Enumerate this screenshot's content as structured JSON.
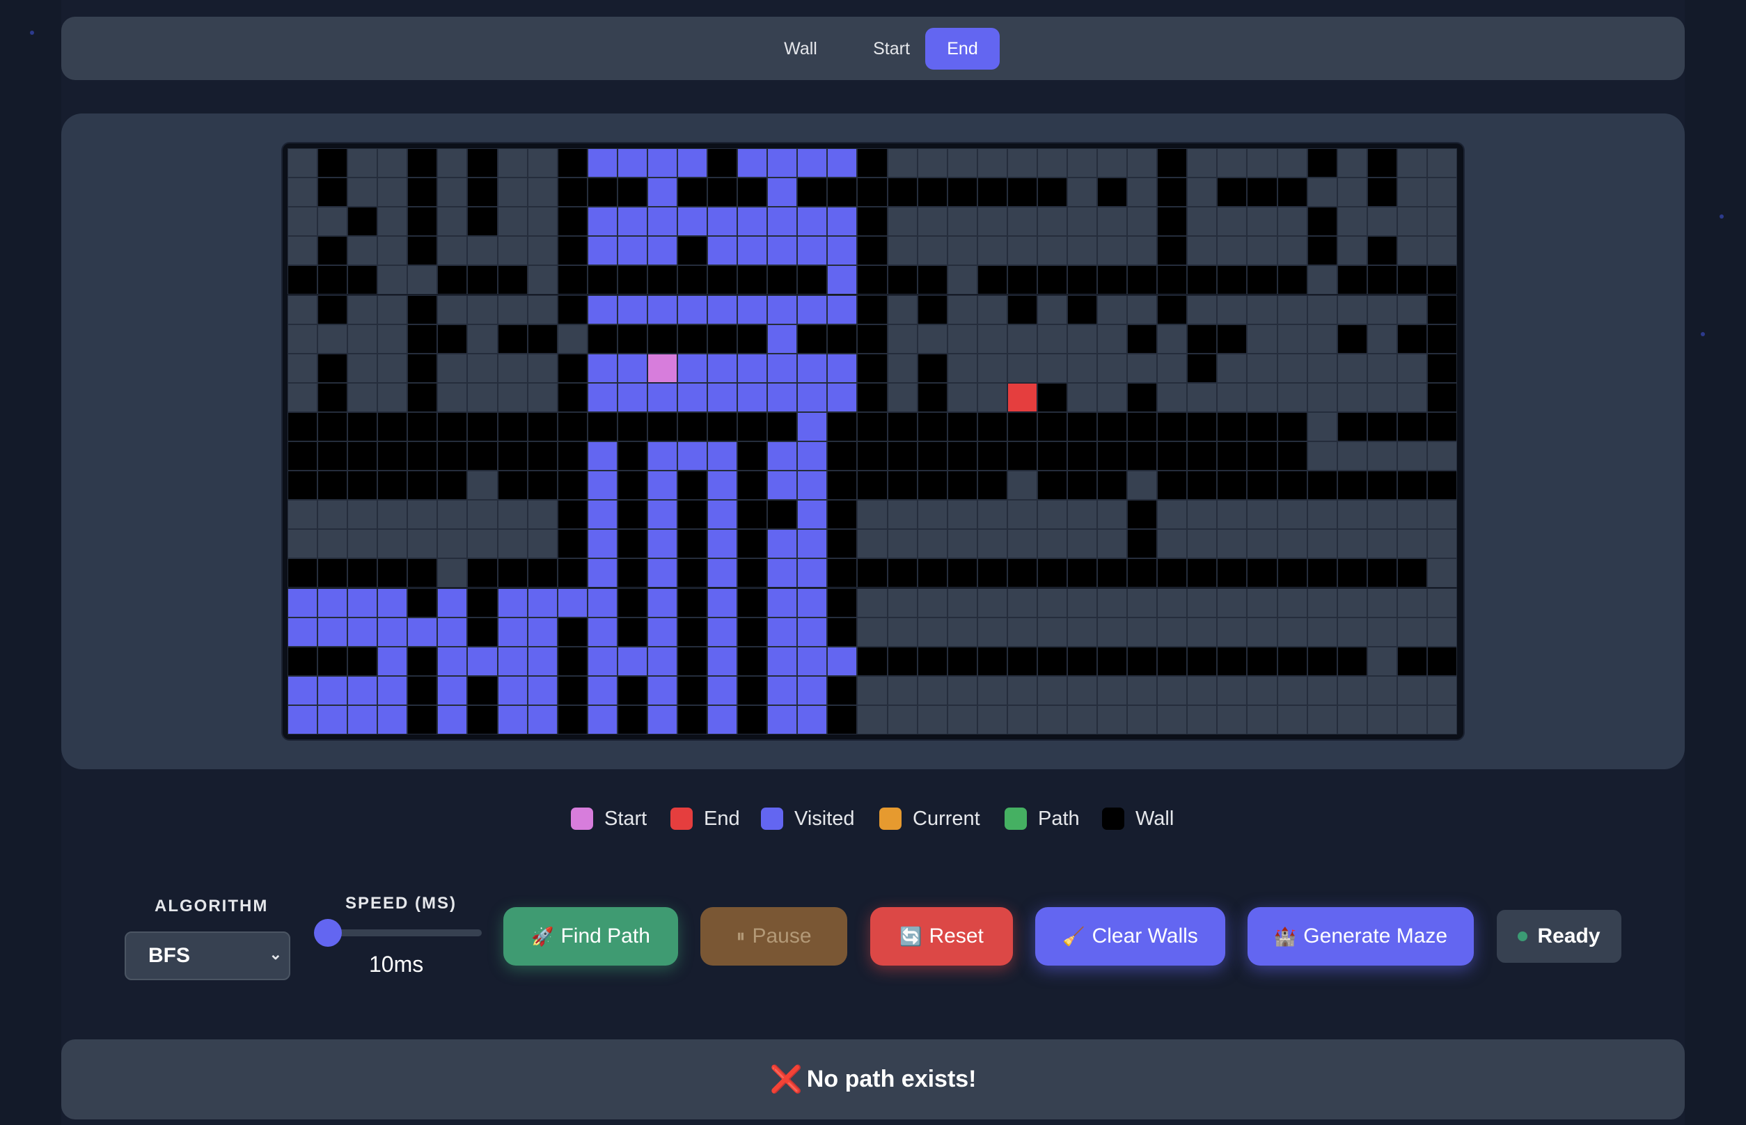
{
  "modes": {
    "items": [
      "Wall",
      "Start",
      "End"
    ],
    "active": "End"
  },
  "legend": [
    {
      "label": "Start",
      "color": "#d77ddc"
    },
    {
      "label": "End",
      "color": "#e53e3e"
    },
    {
      "label": "Visited",
      "color": "#6366f1"
    },
    {
      "label": "Current",
      "color": "#e69a2f"
    },
    {
      "label": "Path",
      "color": "#45b062"
    },
    {
      "label": "Wall",
      "color": "#000000"
    }
  ],
  "controls": {
    "algorithm_label": "ALGORITHM",
    "algorithm_value": "BFS",
    "speed_label": "SPEED (MS)",
    "speed_value": "10ms",
    "speed_level": 0
  },
  "buttons": {
    "find_path": {
      "icon": "rocket-icon",
      "glyph": "🚀",
      "label": "Find Path"
    },
    "pause": {
      "icon": "pause-icon",
      "glyph": "⏸",
      "label": "Pause"
    },
    "reset": {
      "icon": "refresh-icon",
      "glyph": "🔄",
      "label": "Reset"
    },
    "clear_walls": {
      "icon": "broom-icon",
      "glyph": "🧹",
      "label": "Clear Walls"
    },
    "generate_maze": {
      "icon": "castle-icon",
      "glyph": "🏰",
      "label": "Generate Maze"
    }
  },
  "status": {
    "label": "Ready",
    "color": "#3b9b74"
  },
  "message": {
    "icon": "cross-icon",
    "glyph": "❌",
    "text": "No path exists!"
  },
  "colors": {
    "empty": "#374151",
    "wall": "#000000",
    "visited": "#6366f1",
    "start": "#d77ddc",
    "end": "#e53e3e"
  },
  "grid": {
    "legend_key": {
      "W": "wall",
      ".": "empty",
      "V": "visited",
      "S": "start",
      "E": "end"
    },
    "rows": [
      ".W..W.W..WVVVVWVVVVW.........W....W.W..",
      ".W..W.W..WWWVWWWVWWWWWWWWW.W.W.WWW..W..",
      "..W.W.W..WVVVVVVVVVW.........W....W....",
      ".W..W....WVVVWVVVVVW.........W....W.W..",
      "WWW..WWW.WWWWWWWWWVWWW.WWWWWWWWWWW.WWWW",
      ".W..W....WVVVVVVVVVW.W..W.W..W........W",
      "....WW.WW.WWWWWWVWWW........W.WW...W.WW",
      ".W..W....WVVSVVVVVVW.W........W.......W",
      ".W..W....WVVVVVVVVVW.W..EW..W.........W",
      "WWWWWWWWWWWWWWWWWVWWWWWWWWWWWWWWWW.WWWW",
      "WWWWWWWWWWVWVVVWVVWWWWWWWWWWWWWWWW.....",
      "WWWWWW.WWWVWVWVWVVWWWWWW.WWW.WWWWWWWWWW",
      ".........WVWVWVWWVW.........W..........",
      ".........WVWVWVWVVW.........W..........",
      "WWWWW.WWWWVWVWVWVVWWWWWWWWWWWWWWWWWWWW.",
      "VVVVWVWVVVVWVWVWVVW....................",
      "VVVVVVWVVWVWVWVWVVW....................",
      "WWWVWVVVVWVVVWVWVVVWWWWWWWWWWWWWWWWW.WW",
      "VVVVWVWVVWVWVWVWVVW....................",
      "VVVVWVWVVWVWVWVWVVW...................."
    ]
  }
}
